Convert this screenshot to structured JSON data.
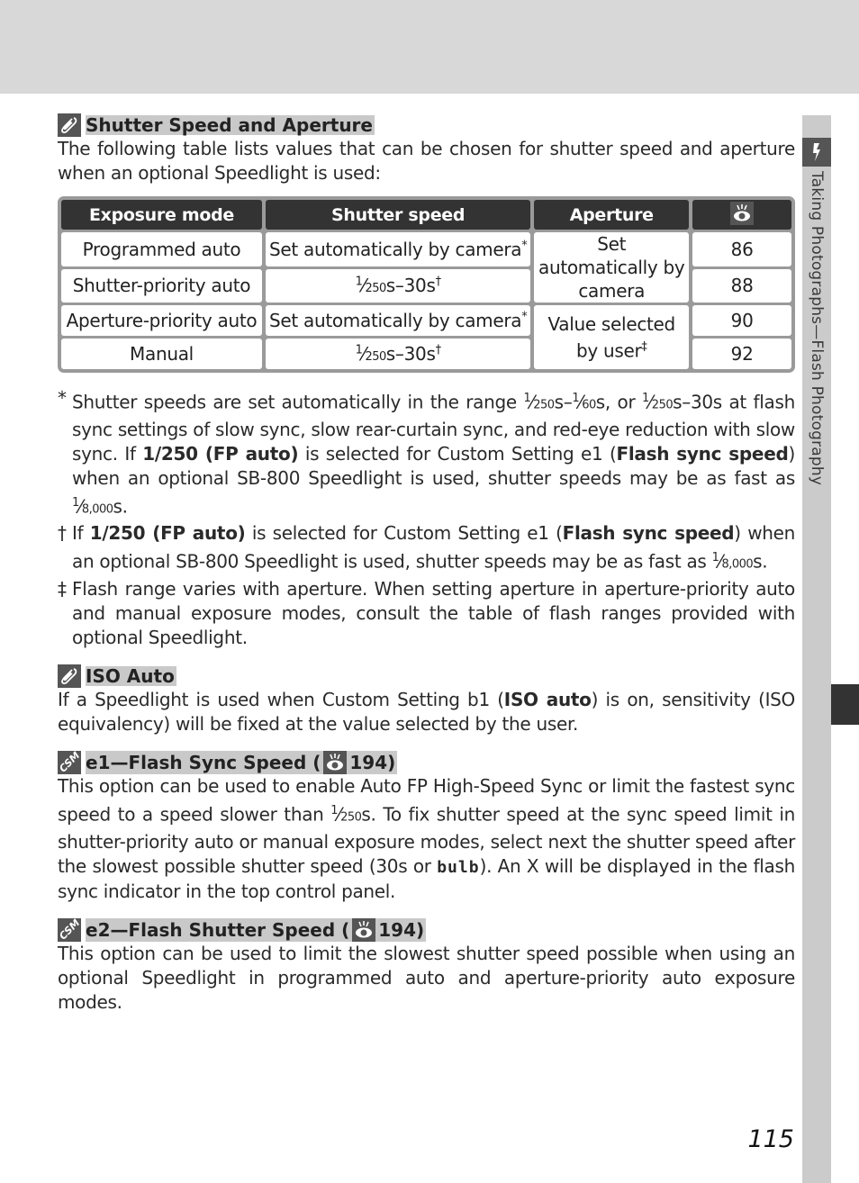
{
  "header_band": "",
  "side_tab": {
    "icon": "flash-icon",
    "title": "Taking Photographs—Flash Photography"
  },
  "page_number": "115",
  "sections": [
    {
      "icon": "note-pencil-icon",
      "title": "Shutter Speed and Aperture",
      "body": "The following table lists values that can be chosen for shutter speed and aperture when an optional Speedlight is used:"
    },
    {
      "icon": "note-pencil-icon",
      "title": "ISO Auto",
      "body_parts": [
        "If a Speedlight is used when Custom Setting b1 (",
        "ISO auto",
        ") is on, sensitivity (ISO equivalency) will be fixed at the value selected by the user."
      ]
    },
    {
      "icon": "csm-icon",
      "title_prefix": "e1—Flash Sync Speed (",
      "title_ref_icon": "page-reference-eye-icon",
      "title_suffix": " 194)",
      "body_parts": [
        "This option can be used to enable Auto FP High-Speed Sync or limit the fastest sync speed to a speed slower than ",
        "1⁄250",
        "s.  To fix shutter speed at the sync speed limit in shutter-priority auto or manual exposure modes, select next the shutter speed after the slowest possible shutter speed (30s or ",
        "bulb",
        ").  An X will be displayed in the flash sync indicator in the top control panel."
      ]
    },
    {
      "icon": "csm-icon",
      "title_prefix": "e2—Flash Shutter Speed (",
      "title_ref_icon": "page-reference-eye-icon",
      "title_suffix": " 194)",
      "body": "This option can be used to limit the slowest shutter speed possible when using an optional Speedlight in programmed auto and aperture-priority auto exposure modes."
    }
  ],
  "table": {
    "headers": [
      "Exposure mode",
      "Shutter speed",
      "Aperture",
      "page-reference-eye-icon"
    ],
    "rows": [
      {
        "mode": "Programmed auto",
        "shutter": "Set automatically by camera",
        "shutter_mark": "*",
        "page": "86"
      },
      {
        "mode": "Shutter-priority auto",
        "shutter_frac": "1⁄250",
        "shutter_rest": "s–30s",
        "shutter_mark": "†",
        "page": "88"
      },
      {
        "mode": "Aperture-priority auto",
        "shutter": "Set automatically by camera",
        "shutter_mark": "*",
        "page": "90"
      },
      {
        "mode": "Manual",
        "shutter_frac": "1⁄250",
        "shutter_rest": "s–30s",
        "shutter_mark": "†",
        "page": "92"
      }
    ],
    "aperture_groups": [
      {
        "text": "Set automatically by camera",
        "mark": "",
        "rows": "1-2"
      },
      {
        "text": "Value selected by user",
        "mark": "‡",
        "rows": "3-4"
      }
    ]
  },
  "footnotes": [
    {
      "mark": "*",
      "parts": [
        "Shutter speeds are set automatically in the range ½⁄250s–½⁄60s, or ½⁄250s–30s at flash sync settings of slow sync, slow rear-curtain sync, and red-eye reduction with slow sync.  If ",
        "1/250 (FP auto)",
        " is selected for Custom Setting e1 (",
        "Flash sync speed",
        ") when an optional SB-800 Speedlight is used, shutter speeds may be as fast as 1⁄8,000s."
      ]
    },
    {
      "mark": "†",
      "parts": [
        "If ",
        "1/250 (FP auto)",
        " is selected for Custom Setting e1 (",
        "Flash sync speed",
        ") when an optional SB-800 Speedlight is used, shutter speeds may be as fast as 1⁄8,000s."
      ]
    },
    {
      "mark": "‡",
      "parts": [
        "Flash range varies with aperture.  When setting aperture in aperture-priority auto and manual exposure modes, consult the table of flash ranges provided with optional Speedlight."
      ]
    }
  ],
  "display": {
    "frac_250": "½⁄",
    "one": "1",
    "sup_250": "250",
    "sup_60": "60",
    "sup_8000": "8,000",
    "s": "s",
    "dash_30s": "–30s",
    "comma_or": ", or ",
    "flash_range_tail": " at flash sync settings of slow sync, slow rear-curtain sync, and red-eye reduction with slow sync.  If ",
    "fn1_start": "Shutter speeds are set automatically in the range ",
    "dash": "–",
    "bulb_lcd": "bulb",
    "fast_as": ") when an optional SB-800 Speedlight is used, shutter speeds may be as fast as ",
    "fast_as_b": ") when an optional SB-800 Speedlight is used, shutter speeds may be as fast as ",
    "period": "s."
  }
}
